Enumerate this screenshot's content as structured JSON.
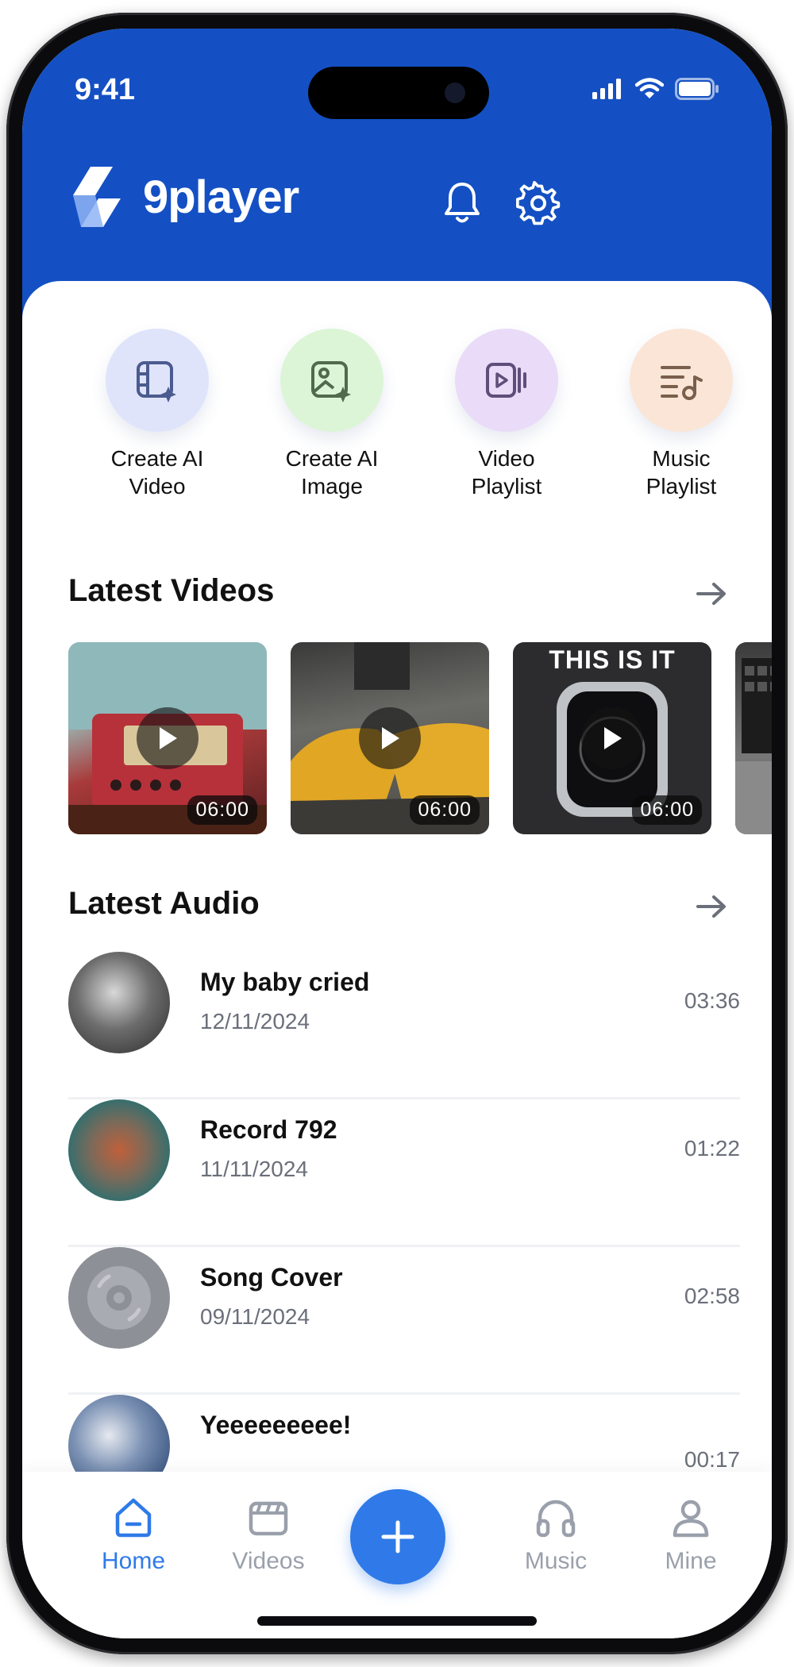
{
  "status_bar": {
    "time": "9:41"
  },
  "header": {
    "app_name": "9player"
  },
  "quick_actions": [
    {
      "line1": "Create AI",
      "line2": "Video",
      "icon": "ai-video-icon",
      "bg": "#dfe4fb",
      "color": "#4b5b8f"
    },
    {
      "line1": "Create AI",
      "line2": "Image",
      "icon": "ai-image-icon",
      "bg": "#dcf5d6",
      "color": "#4f6a4c"
    },
    {
      "line1": "Video",
      "line2": "Playlist",
      "icon": "video-playlist-icon",
      "bg": "#eadcf8",
      "color": "#5e4f7a"
    },
    {
      "line1": "Music",
      "line2": "Playlist",
      "icon": "music-playlist-icon",
      "bg": "#fbe5d6",
      "color": "#7a5f4c"
    }
  ],
  "latest_videos": {
    "title": "Latest Videos",
    "items": [
      {
        "duration": "06:00",
        "tag": ""
      },
      {
        "duration": "06:00",
        "tag": ""
      },
      {
        "duration": "06:00",
        "tag": "THIS IS IT"
      }
    ]
  },
  "latest_audio": {
    "title": "Latest Audio",
    "items": [
      {
        "title": "My baby cried",
        "date": "12/11/2024",
        "duration": "03:36"
      },
      {
        "title": "Record 792",
        "date": "11/11/2024",
        "duration": "01:22"
      },
      {
        "title": "Song Cover",
        "date": "09/11/2024",
        "duration": "02:58"
      },
      {
        "title": "Yeeeeeeeee!",
        "date": "",
        "duration": "00:17"
      }
    ]
  },
  "bottom_nav": {
    "home": "Home",
    "videos": "Videos",
    "music": "Music",
    "mine": "Mine"
  },
  "colors": {
    "brand_blue": "#1450c4",
    "accent": "#2f7ae8",
    "muted": "#9aa0ab"
  }
}
